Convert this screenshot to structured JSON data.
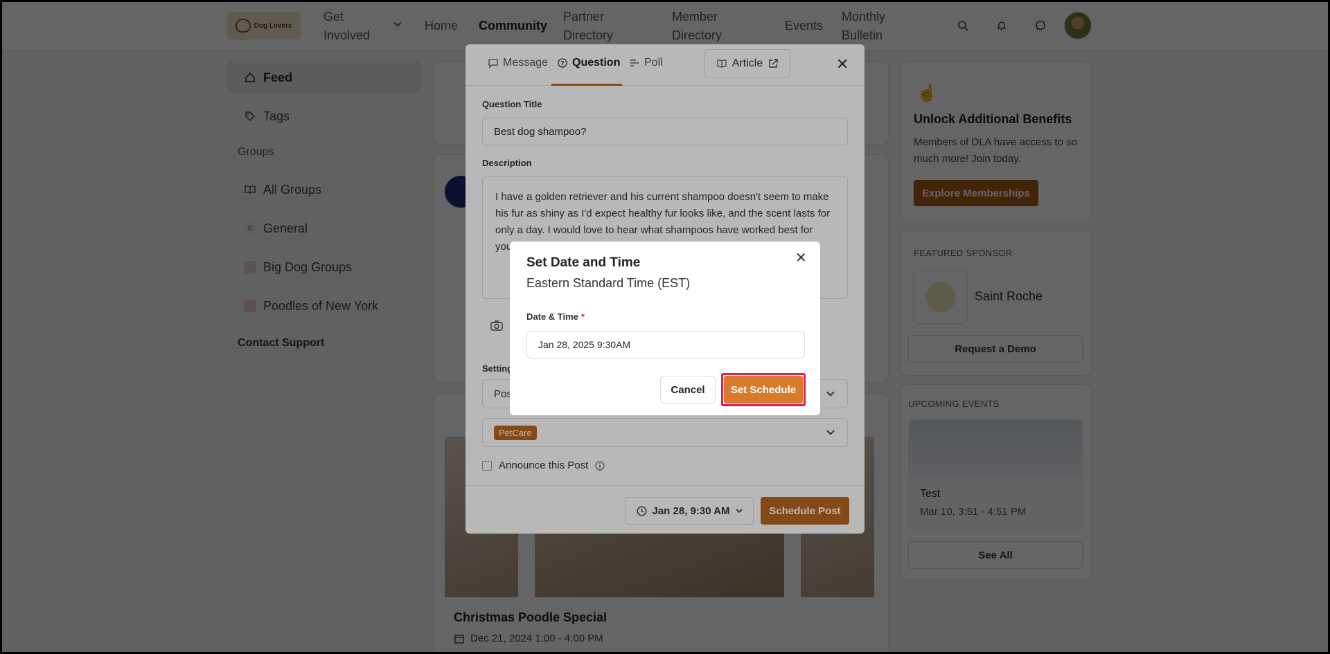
{
  "nav": {
    "logo_text": "Dog Lovers",
    "items": [
      "Get Involved",
      "Home",
      "Community",
      "Partner Directory",
      "Member Directory",
      "Events",
      "Monthly Bulletin"
    ],
    "get_involved_line1": "Get",
    "get_involved_line2": "Involved",
    "partner_line1": "Partner",
    "partner_line2": "Directory",
    "member_line1": "Member",
    "member_line2": "Directory",
    "bulletin_line1": "Monthly",
    "bulletin_line2": "Bulletin"
  },
  "sidebar": {
    "feed": "Feed",
    "tags": "Tags",
    "groups_heading": "Groups",
    "all_groups": "All Groups",
    "general": "General",
    "big_dog_groups": "Big Dog Groups",
    "poodles": "Poodles of New York",
    "contact_support": "Contact Support"
  },
  "feed": {
    "post_title": "Christmas Poodle Special",
    "post_date": "Dec 21, 2024 1:00 - 4:00 PM"
  },
  "right": {
    "unlock_title": "Unlock Additional Benefits",
    "unlock_text": "Members of DLA have access to so much more! Join today.",
    "explore_btn": "Explore Memberships",
    "featured_label": "FEATURED SPONSOR",
    "sponsor_name": "Saint Roche",
    "request_demo": "Request a Demo",
    "events_label": "UPCOMING EVENTS",
    "event_title": "Test",
    "event_time": "Mar 10, 3:51 - 4:51 PM",
    "see_all": "See All"
  },
  "composer": {
    "tabs": [
      "Message",
      "Question",
      "Poll"
    ],
    "article": "Article",
    "question_title_label": "Question Title",
    "question_title_value": "Best dog shampoo?",
    "description_label": "Description",
    "description_value": "I have a golden retriever and his current shampoo doesn't seem to make his fur as shiny as I'd expect healthy fur looks like, and the scent lasts for only a day. I would love to hear what shampoos have worked best for your furry friends!",
    "settings_label": "Setting",
    "post_select": "Pos",
    "tag_chip": "PetCare",
    "announce": "Announce this Post",
    "schedule_time": "Jan 28, 9:30 AM",
    "schedule_post": "Schedule Post"
  },
  "dialog": {
    "title": "Set Date and Time",
    "timezone": "Eastern Standard Time (EST)",
    "field_label": "Date & Time",
    "required_mark": "*",
    "field_value": "Jan 28, 2025 9:30AM",
    "cancel": "Cancel",
    "confirm": "Set Schedule"
  },
  "colors": {
    "brand": "#b8661e",
    "confirm": "#d97a2b",
    "highlight": "#e6195a"
  }
}
